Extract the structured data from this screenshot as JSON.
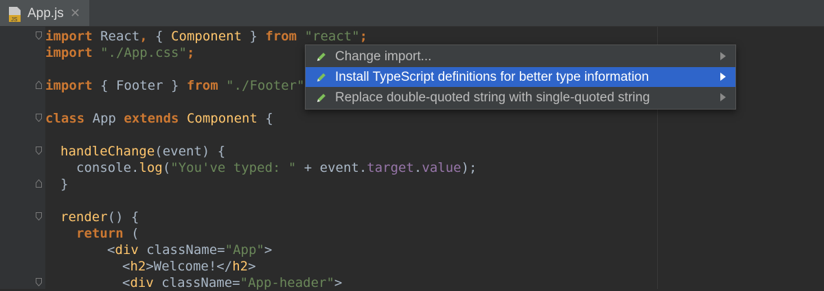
{
  "tab": {
    "title": "App.js",
    "icon_label": "JS",
    "close_glyph": "✕"
  },
  "colors": {
    "keyword": "#cc7832",
    "string": "#6a8759",
    "class": "#ffc66d",
    "property": "#9876aa",
    "text": "#a9b7c6",
    "selection": "#2f65ca"
  },
  "code": {
    "l1": {
      "import": "import",
      "a": " React",
      "comma": ",",
      "b": " { ",
      "comp": "Component",
      "c": " } ",
      "from": "from",
      "d": " ",
      "str": "\"react\"",
      "e": ";"
    },
    "l2": {
      "import": "import",
      "a": " ",
      "str": "\"./App.css\"",
      "e": ";"
    },
    "l3": {
      "import": "import",
      "a": " { Footer } ",
      "from": "from",
      "b": " ",
      "str": "\"./Footer\"",
      "e": ";"
    },
    "l4": {
      "class": "class",
      "a": " App ",
      "extends": "extends",
      "b": " ",
      "comp": "Component",
      "c": " {"
    },
    "l5": {
      "fn": "handleChange",
      "a": "(event) {"
    },
    "l6": {
      "a": "console.",
      "log": "log",
      "b": "(",
      "str": "\"You've typed: \"",
      "c": " + event.",
      "target": "target",
      "d": ".",
      "value": "value",
      "e": ");"
    },
    "l7": {
      "a": "}"
    },
    "l8": {
      "fn": "render",
      "a": "() {"
    },
    "l9": {
      "ret": "return",
      "a": " ("
    },
    "l10": {
      "a": "<",
      "tag": "div",
      "b": " className=",
      "str": "\"App\"",
      "c": ">"
    },
    "l11": {
      "a": "<",
      "tag": "h2",
      "b": ">Welcome!</",
      "tag2": "h2",
      "c": ">"
    },
    "l12": {
      "a": "<",
      "tag": "div",
      "b": " className=",
      "str": "\"App-header\"",
      "c": ">"
    }
  },
  "menu": {
    "items": [
      {
        "label": "Change import...",
        "icon": "pencil-icon",
        "selected": false
      },
      {
        "label": "Install TypeScript definitions for better type information",
        "icon": "pencil-icon",
        "selected": true
      },
      {
        "label": "Replace double-quoted string with single-quoted string",
        "icon": "pencil-icon",
        "selected": false
      }
    ]
  }
}
